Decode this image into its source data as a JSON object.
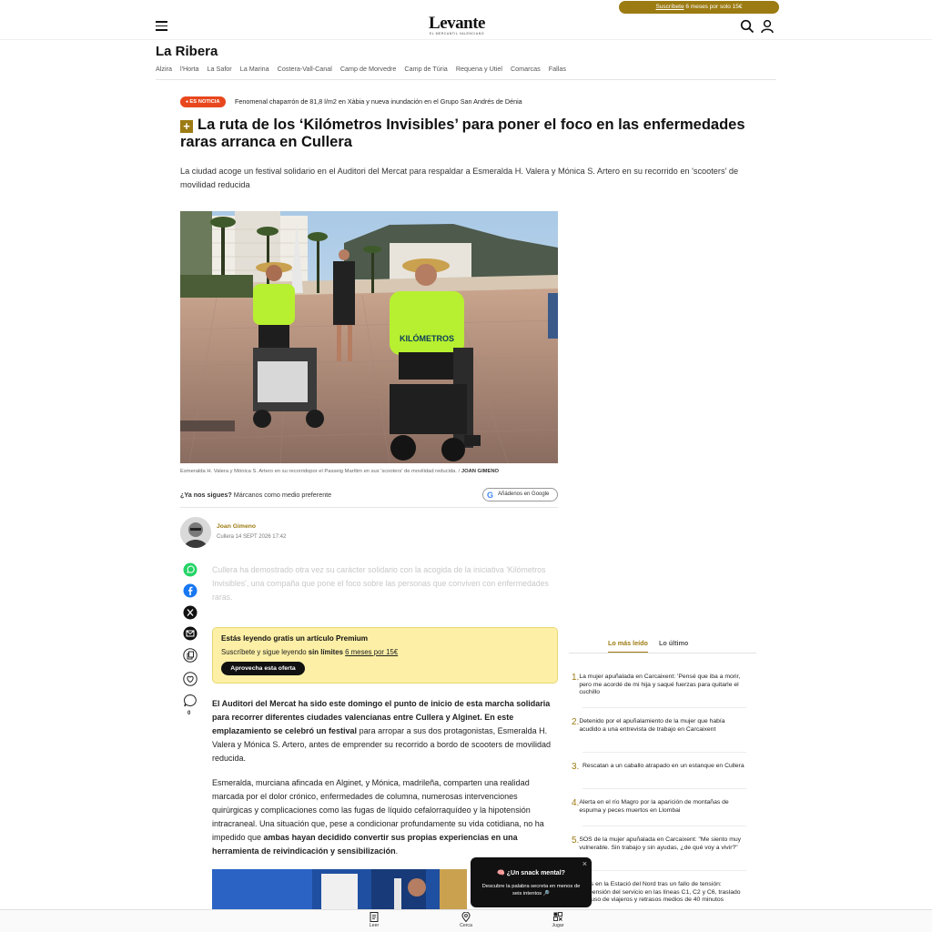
{
  "header": {
    "promo_link": "Suscríbete",
    "promo_rest": " 6 meses por solo 15€",
    "logo": "Levante",
    "logo_tagline": "EL MERCANTIL VALENCIANO",
    "menu_icon": "hamburger-icon",
    "search_icon": "search-icon",
    "account_icon": "user-icon"
  },
  "section": {
    "title": "La Ribera",
    "subnav": [
      "Alzira",
      "l'Horta",
      "La Safor",
      "La Marina",
      "Costera-Vall-Canal",
      "Camp de Morvedre",
      "Camp de Túria",
      "Requena y Utiel",
      "Comarcas",
      "Fallas"
    ]
  },
  "breaking": {
    "badge": "ES NOTICIA",
    "text": "Fenomenal chaparrón de 81,8 l/m2 en Xàbia y nueva inundación en el Grupo San Andrés de Dénia"
  },
  "article": {
    "premium_icon": "+",
    "headline": "La ruta de los ‘Kilómetros Invisibles’ para poner el foco en las enfermedades raras arranca en Cullera",
    "subhead": "La ciudad acoge un festival solidario en el Auditori del Mercat para respaldar a Esmeralda H. Valera y Mónica S. Artero en su recorrido en 'scooters' de movilidad reducida",
    "photo_shirt": "KILÓMETROS",
    "caption": "Esmeralda H. Valera y Mónica S. Artero en su recorridopor el Passeig Marítim en sus 'scooters' de movilidad reducida. / ",
    "caption_credit": "JOAN GIMENO",
    "follow_q": "¿Ya nos sigues?",
    "follow_text": " Márcanos como medio preferente",
    "google_btn": "Añádenos en Google",
    "author": "Joan Gimeno",
    "dateline": "Cullera 14 SEPT 2026 17:42",
    "faded_text": "Cullera ha demostrado otra vez su carácter solidario con la acogida de la iniciativa 'Kilómetros Invisibles', una compaña que pone el foco sobre las personas que conviven con enfermedades raras.",
    "comment_count": "0",
    "paywall": {
      "title": "Estás leyendo gratis un artículo Premium",
      "line_a": "Suscríbete y sigue leyendo ",
      "line_b": "sin límites",
      "line_c": " ",
      "line_link": "6 meses por 15€",
      "cta": "Aprovecha esta oferta"
    },
    "p1": {
      "b1": "El Auditori del Mercat ha sido este domingo el punto de inicio de esta marcha solidaria para recorrer diferentes ciudades valencianas entre Cullera y Alginet. En este emplazamiento se celebró un festival",
      "t1": " para arropar a sus dos protagonistas, Esmeralda H. Valera y Mónica S. Artero, antes de emprender su recorrido a bordo de scooters de movilidad reducida."
    },
    "p2": {
      "t1": "Esmeralda, murciana afincada en Alginet, y Mónica, madrileña, comparten una realidad marcada por el dolor crónico, enfermedades de columna, numerosas intervenciones quirúrgicas y complicaciones como las fugas de líquido cefalorraquídeo y la hipotensión intracraneal. Una situación que, pese a condicionar profundamente su vida cotidiana, no ha impedido que ",
      "b1": "ambas hayan decidido convertir sus propias experiencias en una herramienta de reivindicación y sensibilización",
      "t2": "."
    }
  },
  "share_icons": [
    "whatsapp-icon",
    "facebook-icon",
    "x-icon",
    "email-icon",
    "copy-icon",
    "heart-icon",
    "comment-icon"
  ],
  "sidebar": {
    "tab_active": "Lo más leído",
    "tab_other": "Lo último",
    "items": [
      {
        "n": "1.",
        "text": "La mujer apuñalada en Carcaixent: 'Pensé que iba a morir, pero me acordé de mi hija y saqué fuerzas para quitarle el cuchillo"
      },
      {
        "n": "2.",
        "text": "Detenido por el apuñalamiento de la mujer que había acudido a una entrevista de trabajo en Carcaixent"
      },
      {
        "n": "3.",
        "text": "Rescatan a un caballo atrapado en un estanque en Cullera"
      },
      {
        "n": "4.",
        "text": "Alerta en el río Magro por la aparición de montañas de espuma y peces muertos en Llombai"
      },
      {
        "n": "5.",
        "text": "SOS de la mujer apuñalada en Carcaixent: \"Me siento muy vulnerable. Sin trabajo y sin ayudas, ¿de qué voy a vivir?\""
      },
      {
        "n": "6.",
        "text": "Caos en la Estació del Nord tras un fallo de tensión: suspensión del servicio en las líneas C1, C2 y C6, traslado confuso de viajeros y retrasos medios de 40 minutos"
      }
    ]
  },
  "snack": {
    "title": "🧠 ¿Un snack mental?",
    "desc": "Descubre la palabra secreta en menos de seis intentos 🔎",
    "close": "×"
  },
  "bottom_nav": {
    "read": "Leer",
    "near": "Cerca",
    "play": "Jugar"
  }
}
